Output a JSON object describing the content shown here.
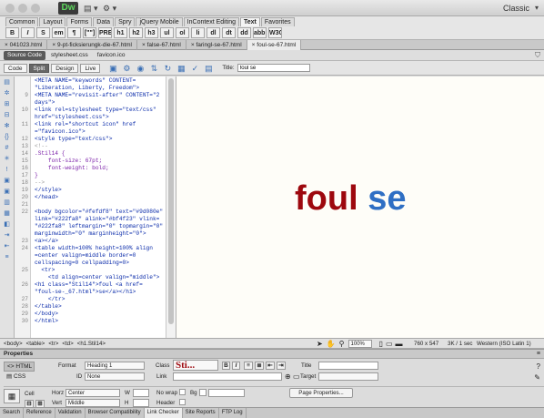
{
  "window": {
    "logo": "Dw",
    "workspace": "Classic"
  },
  "insert_panel": {
    "tabs": [
      "Common",
      "Layout",
      "Forms",
      "Data",
      "Spry",
      "jQuery Mobile",
      "InContext Editing",
      "Text",
      "Favorites"
    ],
    "buttons": [
      "B",
      "I",
      "S",
      "em",
      "¶",
      "[\"\"]",
      "PRE",
      "h1",
      "h2",
      "h3",
      "ul",
      "ol",
      "li",
      "dl",
      "dt",
      "dd",
      "abbr",
      "W3C"
    ]
  },
  "document_tabs": [
    "041023.html",
    "9-pt-ficksierungk-die-67.html",
    "false-67.html",
    "faringl-se-67.html",
    "foul-se-67.html"
  ],
  "related_files": [
    "Source Code",
    "stylesheet.css",
    "favicon.ico"
  ],
  "doc_toolbar": {
    "views": [
      "Code",
      "Split",
      "Design",
      "Live"
    ],
    "title_label": "Title:",
    "title_value": "foul se"
  },
  "code": [
    {
      "n": "",
      "t": "<META NAME=\"keywords\" CONTENT="
    },
    {
      "n": "",
      "t": "\"Liberation, Liberty, Freedom\">"
    },
    {
      "n": "9",
      "t": "<META NAME=\"revisit-after\" CONTENT=\"2"
    },
    {
      "n": "",
      "t": "days\">"
    },
    {
      "n": "10",
      "t": "<link rel=stylesheet type=\"text/css\""
    },
    {
      "n": "",
      "t": "href=\"stylesheet.css\">"
    },
    {
      "n": "11",
      "t": "<link rel=\"shortcut icon\" href"
    },
    {
      "n": "",
      "t": "=\"favicon.ico\">"
    },
    {
      "n": "12",
      "t": "<style type=\"text/css\">"
    },
    {
      "n": "13",
      "t": "<!--"
    },
    {
      "n": "14",
      "t": ".Stil14 {"
    },
    {
      "n": "15",
      "t": "    font-size: 67pt;"
    },
    {
      "n": "16",
      "t": "    font-weight: bold;"
    },
    {
      "n": "17",
      "t": "}"
    },
    {
      "n": "18",
      "t": "-->"
    },
    {
      "n": "19",
      "t": "</style>"
    },
    {
      "n": "20",
      "t": "</head>"
    },
    {
      "n": "21",
      "t": ""
    },
    {
      "n": "22",
      "t": "<body bgcolor=\"#fefdf8\" text=\"#9d080e\""
    },
    {
      "n": "",
      "t": "link=\"#222fa8\" alink=\"#bf4f23\" vlink="
    },
    {
      "n": "",
      "t": "\"#222fa8\" leftmargin=\"0\" topmargin=\"0\""
    },
    {
      "n": "",
      "t": "marginwidth=\"0\" marginheight=\"0\">"
    },
    {
      "n": "23",
      "t": "<a></a>"
    },
    {
      "n": "24",
      "t": "<table width=100% height=100% align"
    },
    {
      "n": "",
      "t": "=center valign=middle border=0"
    },
    {
      "n": "",
      "t": "cellspacing=0 cellpadding=0>"
    },
    {
      "n": "25",
      "t": "  <tr>"
    },
    {
      "n": "",
      "t": "    <td align=center valign=\"middle\">"
    },
    {
      "n": "26",
      "t": "<h1 class=\"Stil14\">foul <a href="
    },
    {
      "n": "",
      "t": "\"foul-se-_67.html\">se</a></h1>"
    },
    {
      "n": "27",
      "t": "    </tr>"
    },
    {
      "n": "28",
      "t": "</table>"
    },
    {
      "n": "29",
      "t": "</body>"
    },
    {
      "n": "30",
      "t": "</html>"
    }
  ],
  "design": {
    "word1": "foul",
    "word2": "se",
    "color1": "#9d080e",
    "color2": "#2f6fc4",
    "background": "#fefdf8"
  },
  "status_bar": {
    "tags": [
      "<body>",
      "<table>",
      "<tr>",
      "<td>",
      "<h1.Stil14>"
    ],
    "zoom": "100%",
    "dimensions": "760 x 547",
    "size": "3K / 1 sec",
    "encoding": "Western (ISO Latin 1)"
  },
  "properties": {
    "panel_title": "Properties",
    "html_label": "HTML",
    "css_label": "CSS",
    "format_label": "Format",
    "format_value": "Heading 1",
    "id_label": "ID",
    "id_value": "None",
    "class_label": "Class",
    "class_value": "Sti...",
    "link_label": "Link",
    "title_label": "Title",
    "target_label": "Target",
    "cell_label": "Cell",
    "horz_label": "Horz",
    "horz_value": "Center",
    "vert_label": "Vert",
    "vert_value": "Middle",
    "w_label": "W",
    "h_label": "H",
    "nowrap_label": "No wrap",
    "bg_label": "Bg",
    "header_label": "Header",
    "page_props_label": "Page Properties...",
    "bold_btn": "B",
    "italic_btn": "I"
  },
  "bottom_tabs": [
    "Search",
    "Reference",
    "Validation",
    "Browser Compatibility",
    "Link Checker",
    "Site Reports",
    "FTP Log"
  ],
  "bottom_tab_active": "Link Checker"
}
